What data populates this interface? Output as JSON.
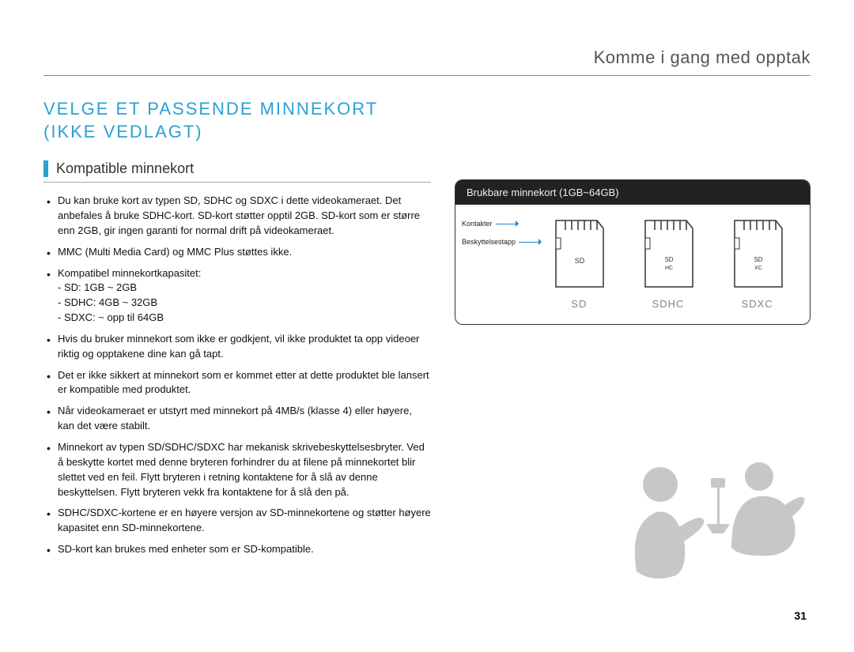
{
  "chapter_title": "Komme i gang med opptak",
  "section_title_line1": "VELGE ET PASSENDE MINNEKORT",
  "section_title_line2": "(IKKE VEDLAGT)",
  "subheading": "Kompatible minnekort",
  "bullets": [
    "Du kan bruke kort av typen SD, SDHC og SDXC i dette videokameraet. Det anbefales å bruke SDHC-kort. SD-kort støtter opptil 2GB. SD-kort som er større enn 2GB, gir ingen garanti for normal drift på videokameraet.",
    "MMC (Multi Media Card) og MMC Plus støttes ikke.",
    "Kompatibel minnekortkapasitet:",
    "Hvis du bruker minnekort som ikke er godkjent, vil ikke produktet ta opp videoer riktig og opptakene dine kan gå tapt.",
    "Det er ikke sikkert at minnekort som er kommet etter at dette produktet ble lansert er kompatible med produktet.",
    "Når videokameraet er utstyrt med minnekort på 4MB/s (klasse 4) eller høyere, kan det være stabilt.",
    "Minnekort av typen SD/SDHC/SDXC har mekanisk skrivebeskyttelsesbryter. Ved å beskytte kortet med denne bryteren forhindrer du at filene på minnekortet blir slettet ved en feil. Flytt bryteren i retning kontaktene for å slå av denne beskyttelsen. Flytt bryteren vekk fra kontaktene for å slå den på.",
    "SDHC/SDXC-kortene er en høyere versjon av SD-minnekortene og støtter høyere kapasitet enn SD-minnekortene.",
    "SD-kort kan brukes med enheter som er SD-kompatible."
  ],
  "capacity_lines": [
    "- SD: 1GB ~ 2GB",
    "- SDHC: 4GB ~ 32GB",
    "- SDXC: ~ opp til 64GB"
  ],
  "card_box": {
    "header": "Brukbare minnekort (1GB~64GB)",
    "label_contacts": "Kontakter",
    "label_protect": "Beskyttelsestapp",
    "cards": [
      "SD",
      "SDHC",
      "SDXC"
    ]
  },
  "page_number": "31"
}
